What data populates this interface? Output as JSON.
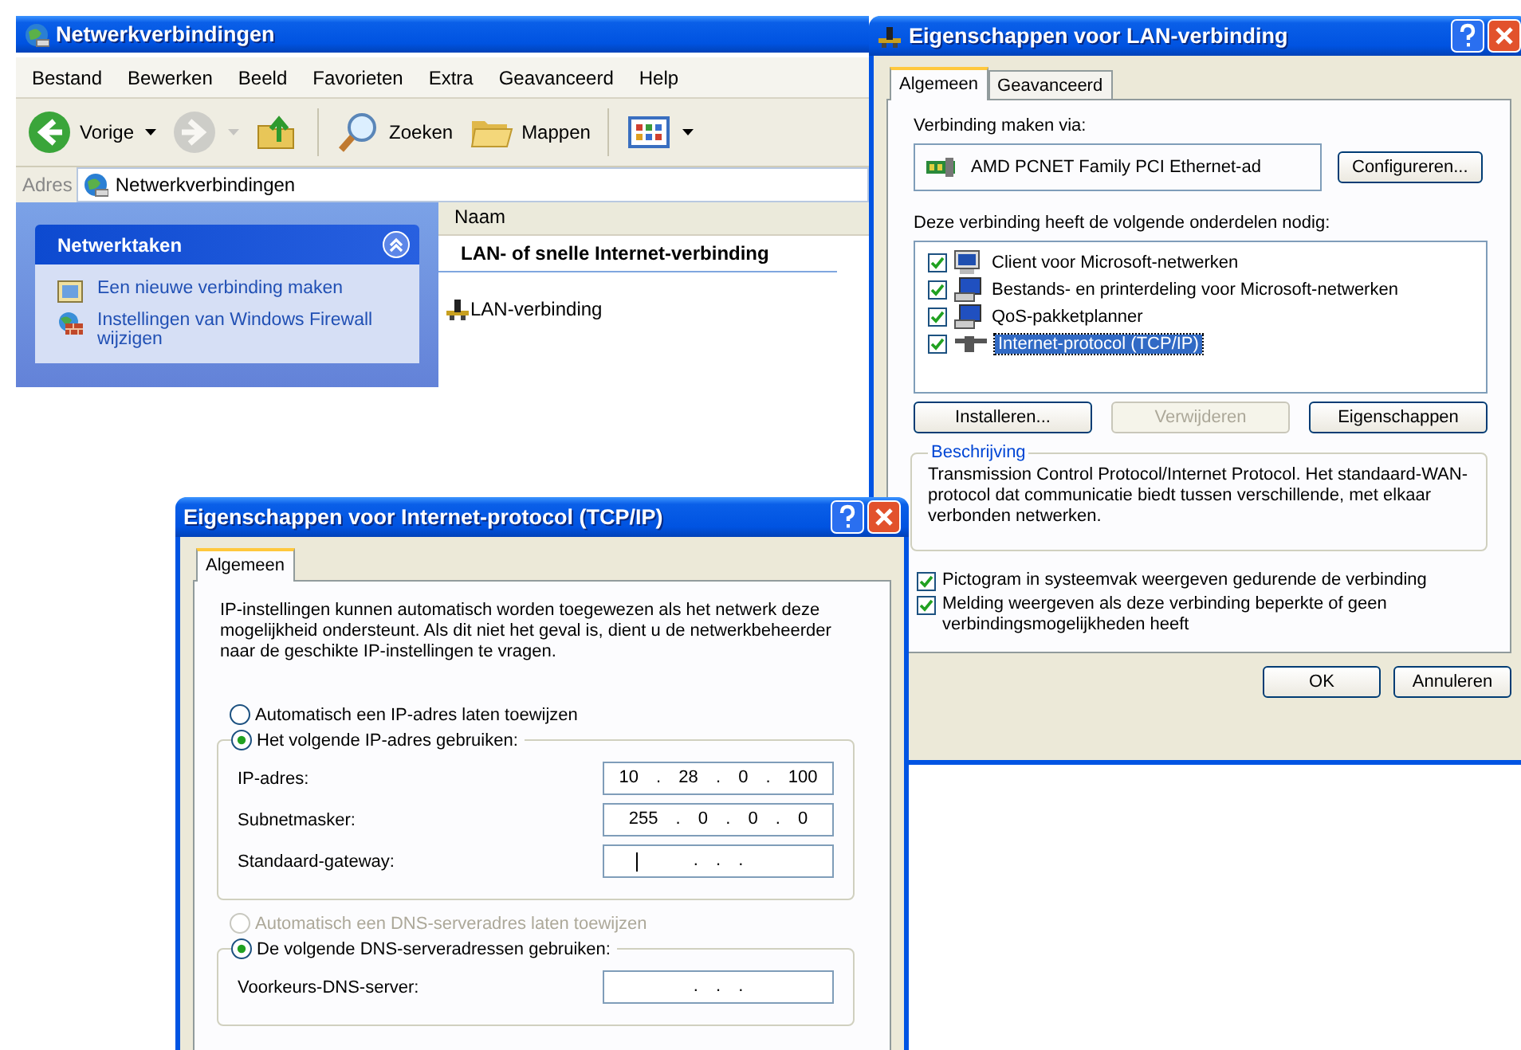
{
  "explorer": {
    "title": "Netwerkverbindingen",
    "menu": [
      "Bestand",
      "Bewerken",
      "Beeld",
      "Favorieten",
      "Extra",
      "Geavanceerd",
      "Help"
    ],
    "toolbar": [
      {
        "kind": "back",
        "label": "Vorige",
        "disabled": false
      },
      {
        "kind": "forward",
        "disabled": true
      },
      {
        "kind": "up",
        "disabled": false
      },
      {
        "kind": "separator"
      },
      {
        "kind": "search",
        "label": "Zoeken",
        "disabled": false
      },
      {
        "kind": "folders",
        "label": "Mappen",
        "disabled": false
      },
      {
        "kind": "separator"
      },
      {
        "kind": "views",
        "disabled": false
      }
    ],
    "address": {
      "label": "Adres",
      "value": "Netwerkverbindingen"
    },
    "task_panel": {
      "title": "Netwerktaken",
      "expanded": true,
      "links": [
        {
          "kind": "new-connection",
          "text": "Een nieuwe verbinding maken"
        },
        {
          "kind": "firewall",
          "text": "Instellingen van Windows Firewall wijzigen"
        }
      ]
    },
    "list": {
      "column": "Naam",
      "group": "LAN- of snelle Internet-verbinding",
      "items": [
        "LAN-verbinding"
      ]
    }
  },
  "lan_dialog": {
    "title": "Eigenschappen voor LAN-verbinding",
    "tabs": [
      {
        "label": "Algemeen",
        "selected": true
      },
      {
        "label": "Geavanceerd",
        "selected": false
      }
    ],
    "connect_label": "Verbinding maken via:",
    "adapter": "AMD PCNET Family PCI Ethernet-ad",
    "configure_button": "Configureren...",
    "components_label": "Deze verbinding heeft de volgende onderdelen nodig:",
    "components": [
      {
        "kind": "client",
        "label": "Client voor Microsoft-netwerken",
        "checked": true,
        "selected": false
      },
      {
        "kind": "service",
        "label": "Bestands- en printerdeling voor Microsoft-netwerken",
        "checked": true,
        "selected": false
      },
      {
        "kind": "service",
        "label": "QoS-pakketplanner",
        "checked": true,
        "selected": false
      },
      {
        "kind": "protocol",
        "label": "Internet-protocol (TCP/IP)",
        "checked": true,
        "selected": true
      }
    ],
    "component_buttons": [
      {
        "label": "Installeren...",
        "disabled": false
      },
      {
        "label": "Verwijderen",
        "disabled": true
      },
      {
        "label": "Eigenschappen",
        "disabled": false
      }
    ],
    "description": {
      "title": "Beschrijving",
      "text": "Transmission Control Protocol/Internet Protocol. Het standaard-WAN-protocol dat communicatie biedt tussen verschillende, met elkaar verbonden netwerken."
    },
    "options": [
      {
        "label": "Pictogram in systeemvak weergeven gedurende de verbinding",
        "checked": true
      },
      {
        "label": "Melding weergeven als deze verbinding beperkte of geen verbindingsmogelijkheden heeft",
        "checked": true
      }
    ],
    "buttons": [
      "OK",
      "Annuleren"
    ]
  },
  "tcpip_dialog": {
    "title": "Eigenschappen voor Internet-protocol (TCP/IP)",
    "tabs": [
      {
        "label": "Algemeen",
        "selected": true
      }
    ],
    "intro": "IP-instellingen kunnen automatisch worden toegewezen als het netwerk deze mogelijkheid ondersteunt. Als dit niet het geval is, dient u de netwerkbeheerder naar de geschikte IP-instellingen te vragen.",
    "ip_mode": [
      {
        "label": "Automatisch een IP-adres laten toewijzen",
        "selected": false,
        "disabled": false
      },
      {
        "label": "Het volgende IP-adres gebruiken:",
        "selected": true,
        "disabled": false
      }
    ],
    "ip_fields": [
      {
        "label": "IP-adres:",
        "value": "10 . 28 . 0 . 100",
        "focused": false
      },
      {
        "label": "Subnetmasker:",
        "value": "255 . 0 . 0 . 0",
        "focused": false
      },
      {
        "label": "Standaard-gateway:",
        "value": ". . .",
        "focused": true
      }
    ],
    "dns_mode": [
      {
        "label": "Automatisch een DNS-serveradres laten toewijzen",
        "selected": false,
        "disabled": true
      },
      {
        "label": "De volgende DNS-serveradressen gebruiken:",
        "selected": true,
        "disabled": false
      }
    ],
    "dns_fields": [
      {
        "label": "Voorkeurs-DNS-server:",
        "value": ". . .",
        "focused": false
      }
    ]
  }
}
